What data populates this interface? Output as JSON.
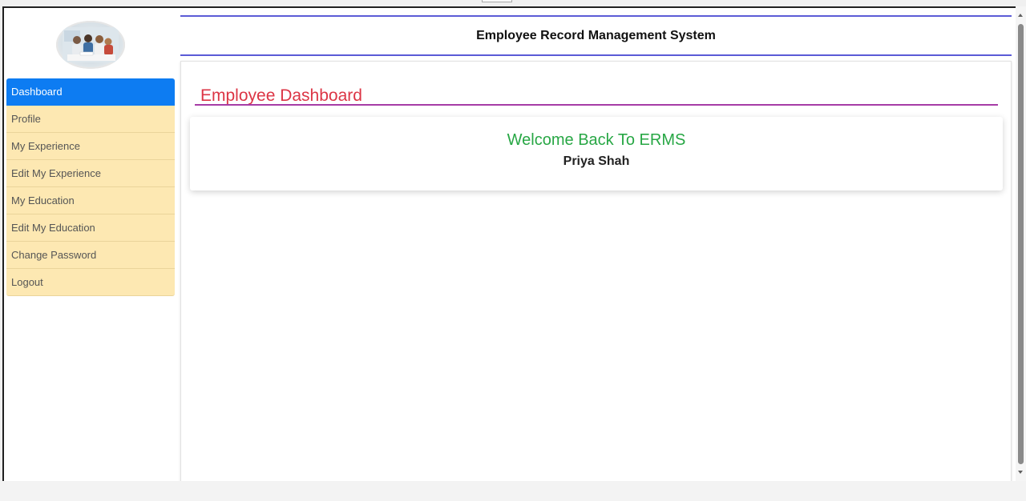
{
  "app": {
    "title": "Employee Record Management System"
  },
  "logo": {
    "icon": "employee-group-photo"
  },
  "sidebar": {
    "items": [
      {
        "label": "Dashboard",
        "active": true
      },
      {
        "label": "Profile",
        "active": false
      },
      {
        "label": "My Experience",
        "active": false
      },
      {
        "label": "Edit My Experience",
        "active": false
      },
      {
        "label": "My Education",
        "active": false
      },
      {
        "label": "Edit My Education",
        "active": false
      },
      {
        "label": "Change Password",
        "active": false
      },
      {
        "label": "Logout",
        "active": false
      }
    ]
  },
  "main": {
    "page_title": "Employee Dashboard",
    "welcome": "Welcome Back To ERMS",
    "user_name": "Priya Shah"
  },
  "colors": {
    "active_item": "#0d7cf2",
    "sidebar_bg": "#fde8b2",
    "page_title": "#dc3545",
    "welcome_text": "#28a745",
    "header_rule": "#5b5bd6",
    "title_rule": "#a63ca6"
  }
}
